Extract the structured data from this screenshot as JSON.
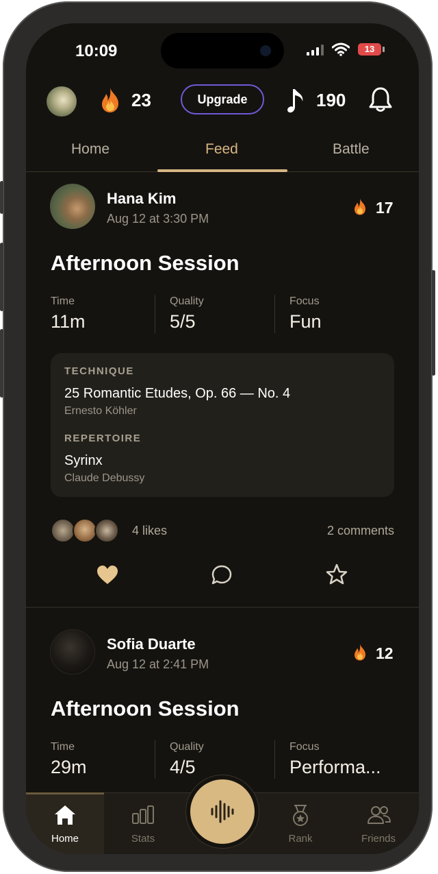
{
  "status_bar": {
    "time": "10:09",
    "battery": "13"
  },
  "header": {
    "streak": "23",
    "upgrade_label": "Upgrade",
    "notes": "190"
  },
  "tabs": [
    {
      "label": "Home",
      "active": false
    },
    {
      "label": "Feed",
      "active": true
    },
    {
      "label": "Battle",
      "active": false
    }
  ],
  "posts": [
    {
      "name": "Hana Kim",
      "date": "Aug 12 at 3:30 PM",
      "streak": "17",
      "title": "Afternoon Session",
      "metrics": [
        {
          "label": "Time",
          "value": "11m"
        },
        {
          "label": "Quality",
          "value": "5/5"
        },
        {
          "label": "Focus",
          "value": "Fun"
        }
      ],
      "pieces": [
        {
          "category": "TECHNIQUE",
          "title": "25 Romantic Etudes, Op. 66 — No. 4",
          "composer": "Ernesto Köhler"
        },
        {
          "category": "REPERTOIRE",
          "title": "Syrinx",
          "composer": "Claude Debussy"
        }
      ],
      "likes": "4 likes",
      "comments": "2 comments"
    },
    {
      "name": "Sofia Duarte",
      "date": "Aug 12 at 2:41 PM",
      "streak": "12",
      "title": "Afternoon Session",
      "metrics": [
        {
          "label": "Time",
          "value": "29m"
        },
        {
          "label": "Quality",
          "value": "4/5"
        },
        {
          "label": "Focus",
          "value": "Performa..."
        }
      ]
    }
  ],
  "nav": [
    {
      "label": "Home",
      "icon": "home-icon",
      "active": true
    },
    {
      "label": "Stats",
      "icon": "bar-chart-icon"
    },
    {
      "label": "Rank",
      "icon": "medal-icon"
    },
    {
      "label": "Friends",
      "icon": "friends-icon"
    }
  ],
  "colors": {
    "accent": "#d6b684",
    "background": "#15130f",
    "flame": "#f07a2a",
    "upgrade_border": "#6f5ad8"
  }
}
